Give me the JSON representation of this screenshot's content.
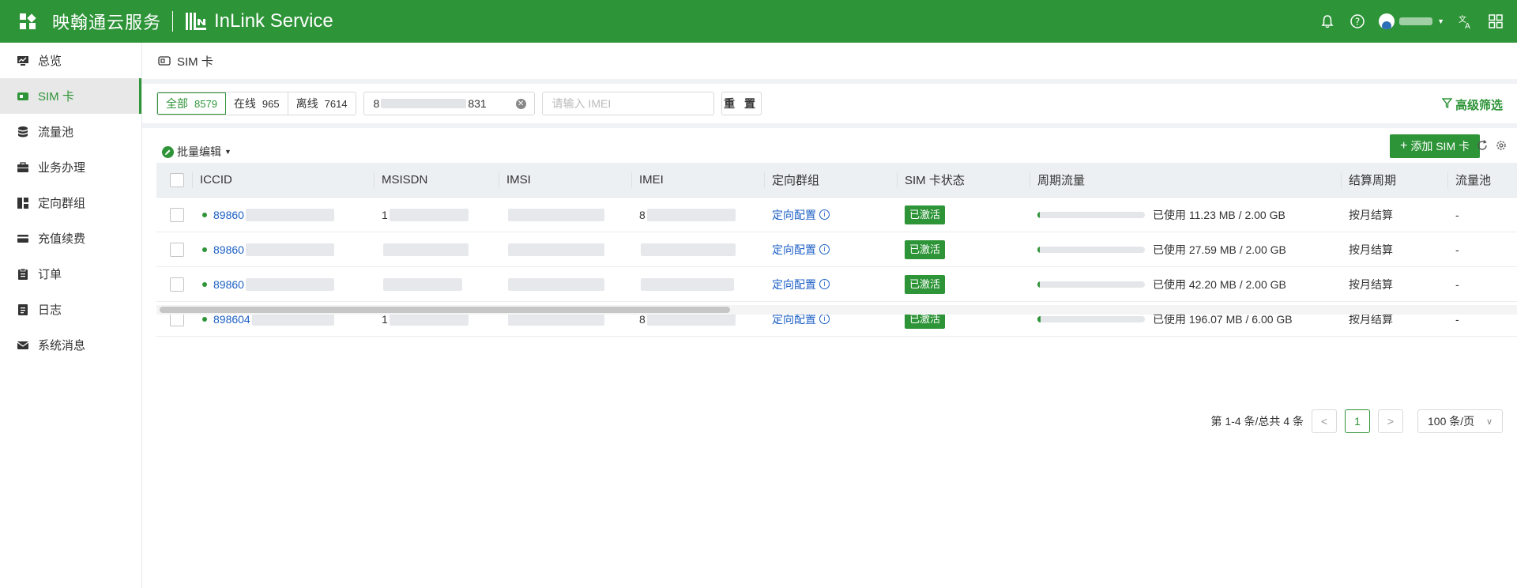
{
  "header": {
    "brand_cn": "映翰通云服务",
    "brand_en": "InLink Service",
    "icons": [
      "apps-icon",
      "bell-icon",
      "help-icon",
      "translate-icon",
      "grid-icon"
    ],
    "accent": "#2e9438"
  },
  "sidebar": {
    "items": [
      {
        "label": "总览",
        "icon": "monitor-icon"
      },
      {
        "label": "SIM 卡",
        "icon": "sim-card-icon",
        "active": true
      },
      {
        "label": "流量池",
        "icon": "database-icon"
      },
      {
        "label": "业务办理",
        "icon": "briefcase-icon"
      },
      {
        "label": "定向群组",
        "icon": "group-icon"
      },
      {
        "label": "充值续费",
        "icon": "card-icon"
      },
      {
        "label": "订单",
        "icon": "clipboard-icon"
      },
      {
        "label": "日志",
        "icon": "log-icon"
      },
      {
        "label": "系统消息",
        "icon": "mail-icon"
      }
    ]
  },
  "page": {
    "title": "SIM 卡"
  },
  "filter": {
    "tabs": [
      {
        "label": "全部",
        "count": "8579",
        "active": true
      },
      {
        "label": "在线",
        "count": "965"
      },
      {
        "label": "离线",
        "count": "7614"
      }
    ],
    "iccid_prefix": "8",
    "iccid_suffix": "831",
    "imei_placeholder": "请输入 IMEI",
    "reset_label": "重 置",
    "advanced_label": "高级筛选"
  },
  "toolbar": {
    "batch_edit_label": "批量编辑",
    "add_sim_label": "添加 SIM 卡"
  },
  "table": {
    "columns": [
      "ICCID",
      "MSISDN",
      "IMSI",
      "IMEI",
      "定向群组",
      "SIM 卡状态",
      "周期流量",
      "结算周期",
      "流量池"
    ],
    "rows": [
      {
        "iccid": "89860",
        "msisdn": "1",
        "imsi": "",
        "imei": "8",
        "group": "定向配置",
        "status": "已激活",
        "usage": "已使用 11.23 MB / 2.00 GB",
        "usage_fraction": 0.0055,
        "cycle": "按月结算",
        "pool": "-"
      },
      {
        "iccid": "89860",
        "msisdn": "",
        "imsi": "",
        "imei": "",
        "group": "定向配置",
        "status": "已激活",
        "usage": "已使用 27.59 MB / 2.00 GB",
        "usage_fraction": 0.0135,
        "cycle": "按月结算",
        "pool": "-"
      },
      {
        "iccid": "89860",
        "msisdn": "",
        "imsi": "",
        "imei": "",
        "group": "定向配置",
        "status": "已激活",
        "usage": "已使用 42.20 MB / 2.00 GB",
        "usage_fraction": 0.0206,
        "cycle": "按月结算",
        "pool": "-"
      },
      {
        "iccid": "898604",
        "msisdn": "1",
        "imsi": "",
        "imei": "8",
        "group": "定向配置",
        "status": "已激活",
        "usage": "已使用 196.07 MB / 6.00 GB",
        "usage_fraction": 0.0319,
        "cycle": "按月结算",
        "pool": "-"
      }
    ]
  },
  "pagination": {
    "summary": "第 1-4 条/总共 4 条",
    "current_page": "1",
    "page_size": "100 条/页"
  }
}
